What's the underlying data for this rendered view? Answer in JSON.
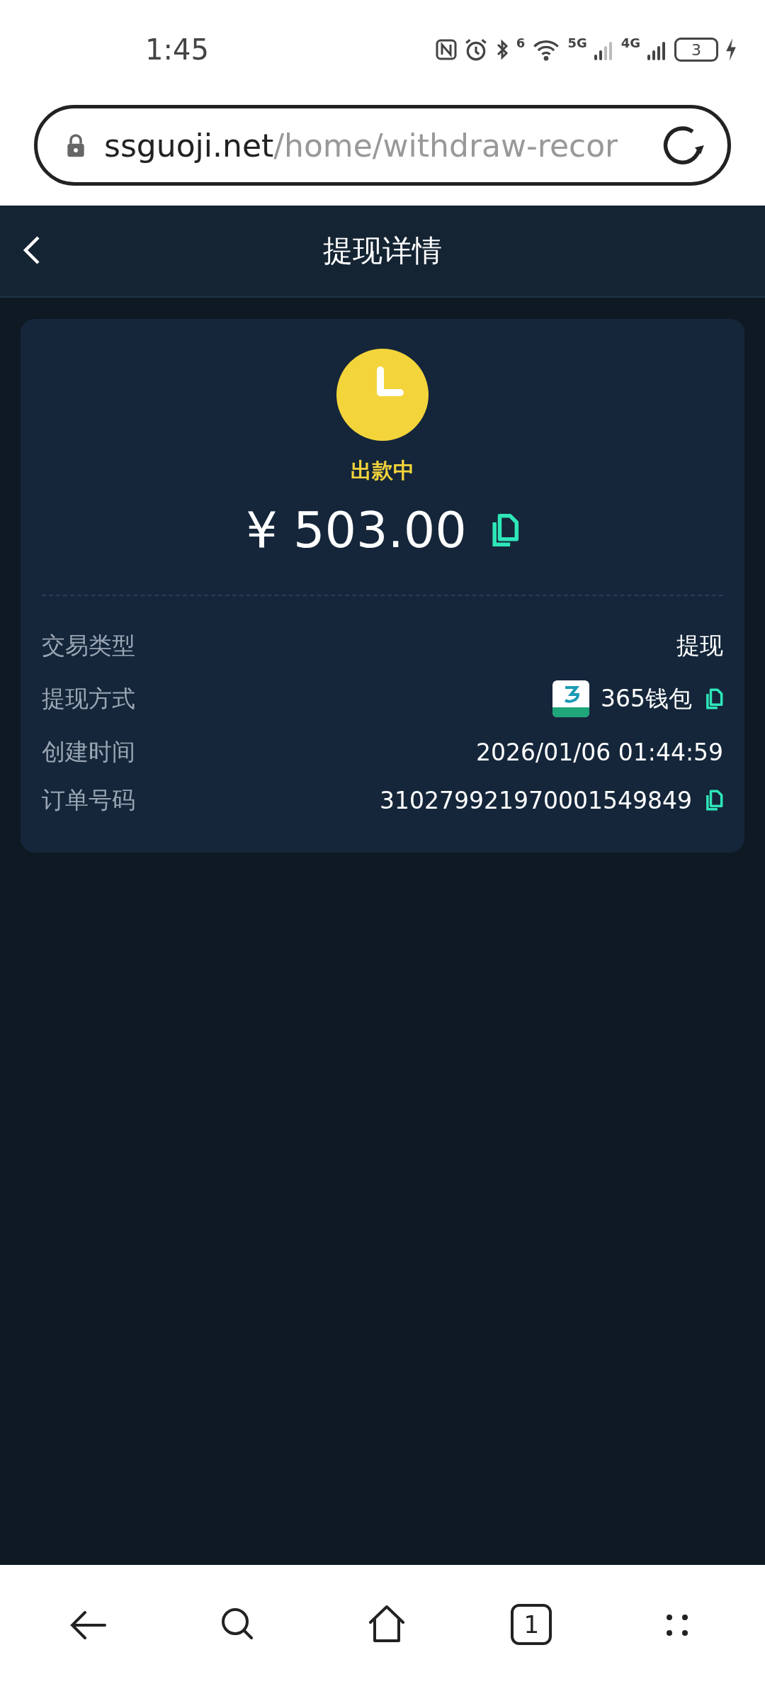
{
  "status_bar": {
    "time": "1:45",
    "wifi_label": "6",
    "signal_labels": [
      "5G",
      "4G"
    ],
    "battery": "3"
  },
  "address_bar": {
    "domain": "ssguoji.net",
    "path": "/home/withdraw-recor"
  },
  "header": {
    "title": "提现详情"
  },
  "card": {
    "status": "出款中",
    "amount": "¥ 503.00",
    "rows": [
      {
        "label": "交易类型",
        "value": "提现",
        "kind": "plain",
        "copyable": false
      },
      {
        "label": "提现方式",
        "value": "365钱包",
        "kind": "wallet",
        "copyable": true
      },
      {
        "label": "创建时间",
        "value": "2026/01/06 01:44:59",
        "kind": "plain",
        "copyable": false
      },
      {
        "label": "订单号码",
        "value": "310279921970001549849",
        "kind": "plain",
        "copyable": true
      }
    ]
  },
  "bottom_bar": {
    "tab_count": "1"
  }
}
